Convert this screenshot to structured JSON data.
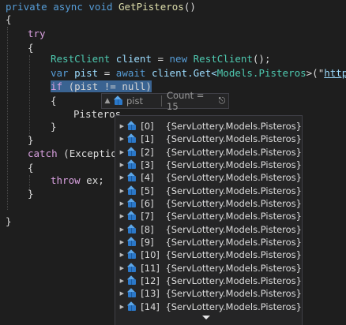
{
  "code": {
    "method_signature": {
      "kw_private": "private",
      "kw_async": "async",
      "kw_void": "void",
      "method_name": "GetPisteros",
      "parens": "()"
    },
    "open_brace_outer": "{",
    "try_keyword": "try",
    "open_brace_try": "{",
    "line_restclient": {
      "type1": "RestClient",
      "varname": "client",
      "eq": " = ",
      "kw_new": "new",
      "type2": "RestClient",
      "tail": "();"
    },
    "line_await": {
      "kw_var": "var",
      "varname": "pist",
      "eq": " = ",
      "kw_await": "await",
      "call": "client.Get<",
      "generic": "Models.Pisteros",
      "mid": ">(\"",
      "url_fragment": "https:"
    },
    "line_if": {
      "kw_if": "if",
      "cond": " (pist != null)"
    },
    "open_brace_if": "{",
    "line_pisteros": "Pisteros",
    "close_brace_if": "}",
    "close_brace_try": "}",
    "line_catch": {
      "kw_catch": "catch",
      "rest": " (Exceptio"
    },
    "open_brace_catch": "{",
    "line_throw": {
      "kw_throw": "throw",
      "rest": " ex;"
    },
    "close_brace_catch": "}",
    "close_brace_outer": "}"
  },
  "datatip": {
    "variable_name": "pist",
    "count_text": "Count = 15",
    "items": [
      {
        "index": "[0]",
        "value": "{ServLottery.Models.Pisteros}"
      },
      {
        "index": "[1]",
        "value": "{ServLottery.Models.Pisteros}"
      },
      {
        "index": "[2]",
        "value": "{ServLottery.Models.Pisteros}"
      },
      {
        "index": "[3]",
        "value": "{ServLottery.Models.Pisteros}"
      },
      {
        "index": "[4]",
        "value": "{ServLottery.Models.Pisteros}"
      },
      {
        "index": "[5]",
        "value": "{ServLottery.Models.Pisteros}"
      },
      {
        "index": "[6]",
        "value": "{ServLottery.Models.Pisteros}"
      },
      {
        "index": "[7]",
        "value": "{ServLottery.Models.Pisteros}"
      },
      {
        "index": "[8]",
        "value": "{ServLottery.Models.Pisteros}"
      },
      {
        "index": "[9]",
        "value": "{ServLottery.Models.Pisteros}"
      },
      {
        "index": "[10]",
        "value": "{ServLottery.Models.Pisteros}"
      },
      {
        "index": "[11]",
        "value": "{ServLottery.Models.Pisteros}"
      },
      {
        "index": "[12]",
        "value": "{ServLottery.Models.Pisteros}"
      },
      {
        "index": "[13]",
        "value": "{ServLottery.Models.Pisteros}"
      },
      {
        "index": "[14]",
        "value": "{ServLottery.Models.Pisteros}"
      }
    ]
  },
  "colors": {
    "background": "#1e1e1e",
    "keyword": "#569cd6",
    "control_keyword": "#d8a0df",
    "type": "#4ec9b0",
    "method": "#dcdcaa",
    "variable": "#9cdcfe",
    "selection": "#3a6391"
  },
  "icons": {
    "object": "object-cube-icon",
    "expand": "chevron-right-icon",
    "pin": "pin-icon",
    "scroll_down": "scroll-down-arrow-icon"
  }
}
